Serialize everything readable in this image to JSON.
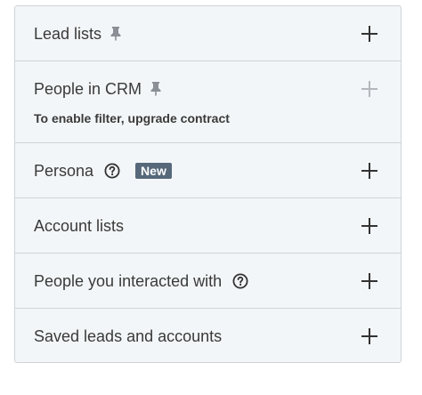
{
  "filters": {
    "lead_lists": {
      "label": "Lead lists",
      "icon": "pin-icon",
      "action_icon": "plus-icon"
    },
    "people_in_crm": {
      "label": "People in CRM",
      "icon": "pin-icon",
      "subtext": "To enable filter, upgrade contract",
      "action_icon": "plus-icon",
      "disabled": true
    },
    "persona": {
      "label": "Persona",
      "icon": "help-icon",
      "badge": "New",
      "action_icon": "plus-icon"
    },
    "account_lists": {
      "label": "Account lists",
      "action_icon": "plus-icon"
    },
    "people_interacted": {
      "label": "People you interacted with",
      "icon": "help-icon",
      "action_icon": "plus-icon"
    },
    "saved_leads": {
      "label": "Saved leads and accounts",
      "action_icon": "plus-icon"
    }
  },
  "colors": {
    "panel_background": "#f3f6f8",
    "border": "#d0d4d8",
    "badge_background": "#56687a",
    "text": "#3a3a3a",
    "disabled_icon": "#b3b8bd"
  }
}
